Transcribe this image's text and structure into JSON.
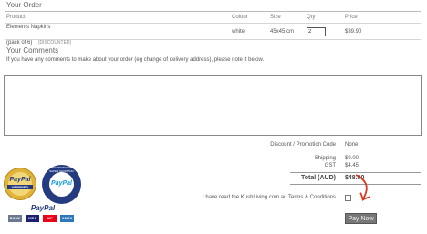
{
  "order": {
    "title": "Your Order",
    "columns": [
      "Product",
      "Colour",
      "Size",
      "Qty",
      "Price"
    ],
    "row": {
      "product": "Elements Napkins",
      "pack": "(pack of 6)",
      "discount_tag": "(DISCOUNTED)",
      "colour": "white",
      "size": "45x45 cm",
      "qty": "2",
      "price": "$39.90"
    }
  },
  "comments": {
    "title": "Your Comments",
    "instructions": "If you have any comments to make about your order (eg change of delivery address), please note it below.",
    "value": ""
  },
  "summary": {
    "discount_label": "Discount / Promotion Code",
    "discount_value": "None",
    "shipping_label": "Shipping",
    "shipping_value": "$9.00",
    "gst_label": "GST",
    "gst_value": "$4.45",
    "total_label": "Total (AUD)",
    "total_value": "$48.90"
  },
  "terms": {
    "label": "I have read the KushLiving.com.au Terms & Conditions",
    "checked": false
  },
  "pay_button": "Pay Now",
  "badges": {
    "verified_top": "PayPal",
    "verified_bottom": "VERIFIED",
    "protection_ring": "BUYER PROTECTION · SAFER SHOPPING",
    "protection_center": "PayPal",
    "strip_title": "PayPal",
    "cards": [
      "BANK",
      "VISA",
      "MC",
      "AMEX"
    ]
  },
  "colors": {
    "accent_red": "#d6371f",
    "paypal_blue": "#253b80",
    "paypal_light": "#179bd7",
    "seal_gold": "#e0b43a"
  }
}
